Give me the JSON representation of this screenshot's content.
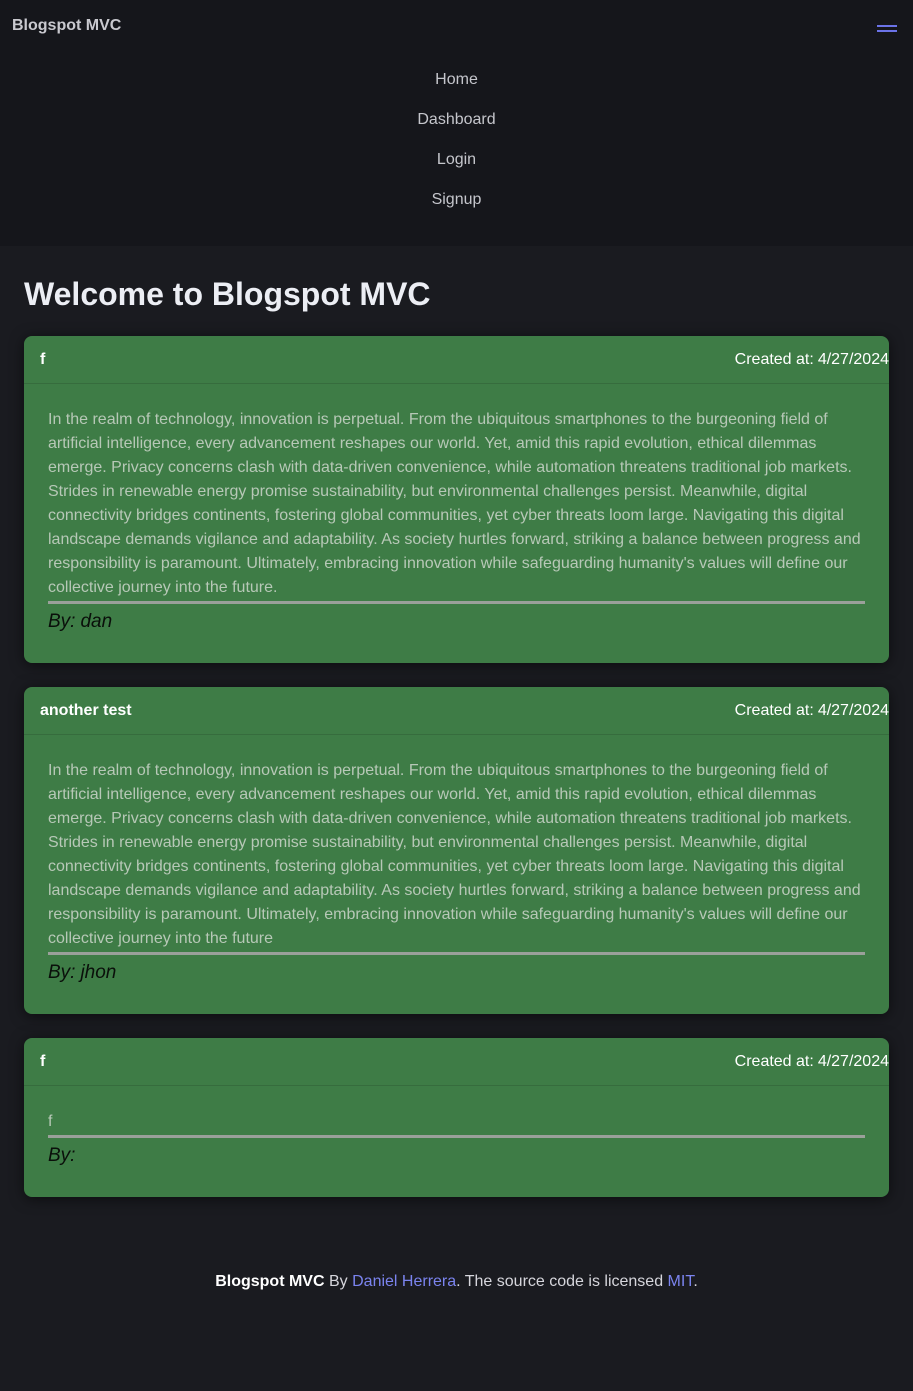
{
  "navbar": {
    "brand": "Blogspot MVC",
    "menu_icon": "hamburger-menu-icon",
    "links": [
      "Home",
      "Dashboard",
      "Login",
      "Signup"
    ]
  },
  "main": {
    "title": "Welcome to Blogspot MVC",
    "posts": [
      {
        "title": "f",
        "date_label": "Created at:",
        "date": "4/27/2024",
        "content": "In the realm of technology, innovation is perpetual. From the ubiquitous smartphones to the burgeoning field of artificial intelligence, every advancement reshapes our world. Yet, amid this rapid evolution, ethical dilemmas emerge. Privacy concerns clash with data-driven convenience, while automation threatens traditional job markets. Strides in renewable energy promise sustainability, but environmental challenges persist. Meanwhile, digital connectivity bridges continents, fostering global communities, yet cyber threats loom large. Navigating this digital landscape demands vigilance and adaptability. As society hurtles forward, striking a balance between progress and responsibility is paramount. Ultimately, embracing innovation while safeguarding humanity's values will define our collective journey into the future.",
        "by_label": "By:",
        "author": "dan"
      },
      {
        "title": "another test",
        "date_label": "Created at:",
        "date": "4/27/2024",
        "content": "In the realm of technology, innovation is perpetual. From the ubiquitous smartphones to the burgeoning field of artificial intelligence, every advancement reshapes our world. Yet, amid this rapid evolution, ethical dilemmas emerge. Privacy concerns clash with data-driven convenience, while automation threatens traditional job markets. Strides in renewable energy promise sustainability, but environmental challenges persist. Meanwhile, digital connectivity bridges continents, fostering global communities, yet cyber threats loom large. Navigating this digital landscape demands vigilance and adaptability. As society hurtles forward, striking a balance between progress and responsibility is paramount. Ultimately, embracing innovation while safeguarding humanity's values will define our collective journey into the future",
        "by_label": "By:",
        "author": "jhon"
      },
      {
        "title": "f",
        "date_label": "Created at:",
        "date": "4/27/2024",
        "content": "f",
        "by_label": "By:",
        "author": ""
      }
    ]
  },
  "footer": {
    "brand": "Blogspot MVC",
    "by_text": "By",
    "author_link": "Daniel Herrera",
    "license_text": ". The source code is licensed",
    "license_link": "MIT",
    "end": "."
  },
  "colors": {
    "card_background": "#3e7c46",
    "link_accent": "#7b84ef",
    "page_background": "#1a1b20"
  }
}
